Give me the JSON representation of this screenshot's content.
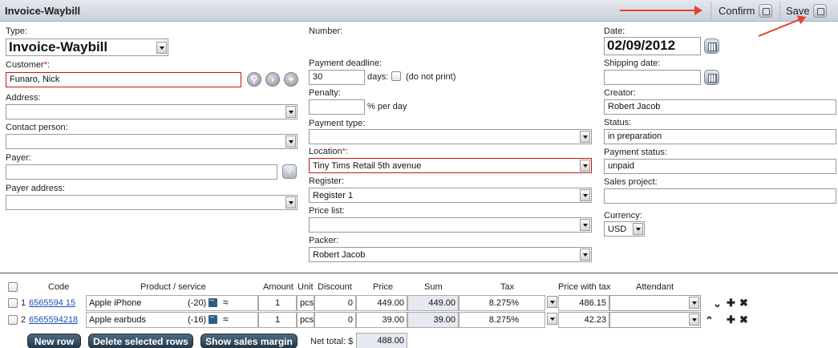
{
  "window": {
    "title": "Invoice-Waybill"
  },
  "toolbar": {
    "confirm_label": "Confirm",
    "save_label": "Save"
  },
  "left": {
    "type_label": "Type:",
    "type_value": "Invoice-Waybill",
    "customer_label": "Customer",
    "customer_required": "*",
    "customer_colon": ":",
    "customer_value": "Funaro, Nick",
    "address_label": "Address:",
    "address_value": "",
    "contact_label": "Contact person:",
    "contact_value": "",
    "payer_label": "Payer:",
    "payer_value": "",
    "payer_address_label": "Payer address:",
    "payer_address_value": ""
  },
  "middle": {
    "number_label": "Number:",
    "deadline_label": "Payment deadline:",
    "deadline_value": "30",
    "days_label": "days:",
    "no_print_label": "(do not print)",
    "penalty_label": "Penalty:",
    "penalty_value": "",
    "penalty_unit": "% per day",
    "payment_type_label": "Payment type:",
    "payment_type_value": "",
    "location_label": "Location",
    "location_required": "*",
    "location_colon": ":",
    "location_value": "Tiny Tims Retail 5th avenue",
    "register_label": "Register:",
    "register_value": "Register 1",
    "price_list_label": "Price list:",
    "price_list_value": "",
    "packer_label": "Packer:",
    "packer_value": "Robert Jacob"
  },
  "right": {
    "date_label": "Date:",
    "date_value": "02/09/2012",
    "shipping_label": "Shipping date:",
    "shipping_value": "",
    "creator_label": "Creator:",
    "creator_value": "Robert Jacob",
    "status_label": "Status:",
    "status_value": "in preparation",
    "payment_status_label": "Payment status:",
    "payment_status_value": "unpaid",
    "sales_project_label": "Sales project:",
    "sales_project_value": "",
    "currency_label": "Currency:",
    "currency_value": "USD"
  },
  "table": {
    "headers": {
      "code": "Code",
      "product": "Product / service",
      "amount": "Amount",
      "unit": "Unit",
      "discount": "Discount",
      "price": "Price",
      "sum": "Sum",
      "tax": "Tax",
      "price_with_tax": "Price with tax",
      "attendant": "Attendant"
    },
    "rows": [
      {
        "num": "1",
        "code": "6565594 15",
        "product": "Apple iPhone",
        "stock": "(-20)",
        "amount": "1",
        "unit": "pcs",
        "discount": "0",
        "price": "449.00",
        "sum": "449.00",
        "tax": "8.275%",
        "price_with_tax": "486.15",
        "attendant": ""
      },
      {
        "num": "2",
        "code": "6565594218",
        "product": "Apple earbuds",
        "stock": "(-16)",
        "amount": "1",
        "unit": "pcs",
        "discount": "0",
        "price": "39.00",
        "sum": "39.00",
        "tax": "8.275%",
        "price_with_tax": "42.23",
        "attendant": ""
      }
    ]
  },
  "footer": {
    "new_row_label": "New row",
    "delete_rows_label": "Delete selected rows",
    "sales_margin_label": "Show sales margin",
    "net_total_label": "Net total: $",
    "net_total_value": "488.00"
  },
  "colors": {
    "required_border": "#c01818",
    "action_button": "#2c4457",
    "link": "#1a4fb5",
    "annotation_arrow": "#e8412c"
  }
}
